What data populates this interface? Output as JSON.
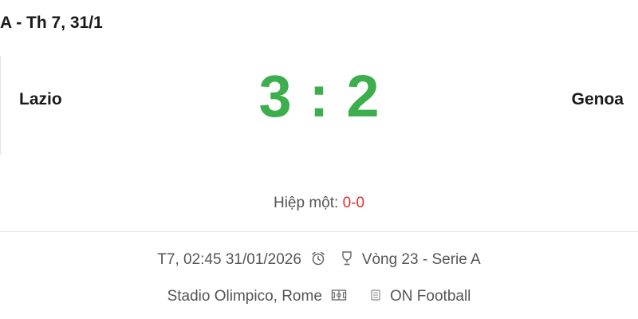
{
  "header": {
    "title": "A - Th 7, 31/1"
  },
  "match": {
    "home_team": "Lazio",
    "away_team": "Genoa",
    "home_score": "3",
    "away_score": "2",
    "score_separator": ":",
    "halftime_label": "Hiệp một:",
    "halftime_score": "0-0"
  },
  "details": {
    "datetime": "T7, 02:45 31/01/2026",
    "round": "Vòng 23 - Serie A",
    "venue": "Stadio Olimpico, Rome",
    "broadcaster": "ON Football",
    "icons": [
      "alarm-clock-icon",
      "trophy-icon",
      "stadium-icon",
      "tv-icon"
    ]
  },
  "colors": {
    "score": "#3cae4d",
    "halftime_score": "#e0312b"
  }
}
